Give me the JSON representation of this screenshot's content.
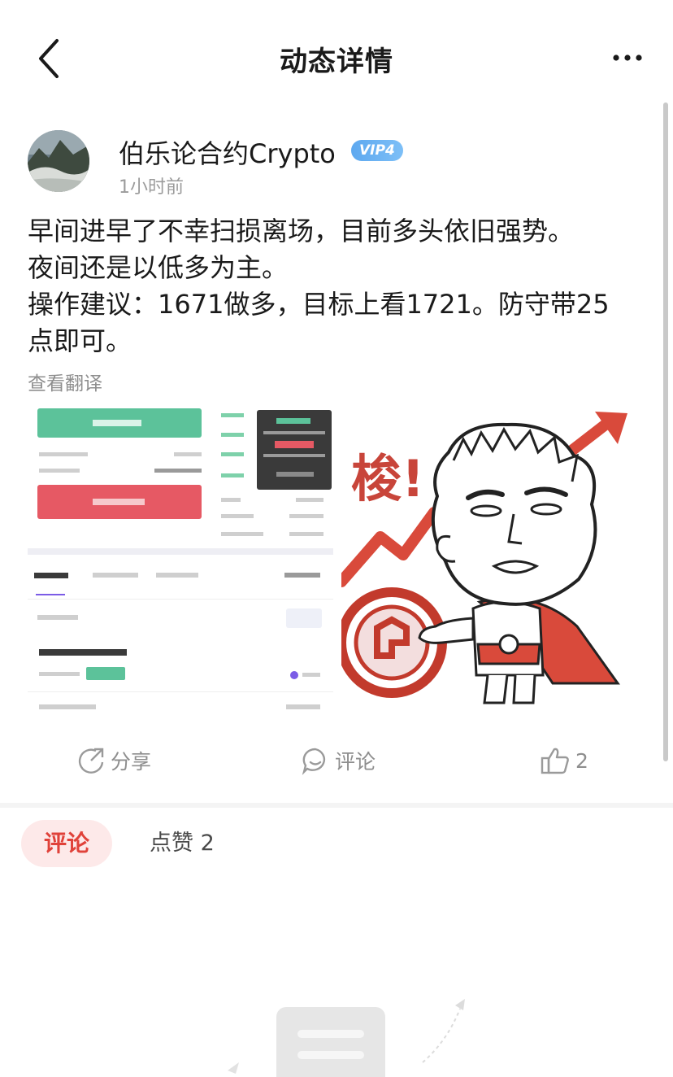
{
  "header": {
    "title": "动态详情",
    "back_icon": "chevron-left-icon",
    "more_icon": "more-horizontal-icon"
  },
  "author": {
    "name": "伯乐论合约Crypto",
    "badge": "VIP4",
    "time": "1小时前"
  },
  "post": {
    "lines": [
      "早间进早了不幸扫损离场，目前多头依旧强势。",
      "夜间还是以低多为主。",
      "操作建议：1671做多，目标上看1721。防守带25",
      "点即可。"
    ],
    "translate_label": "查看翻译"
  },
  "images": {
    "image1_label": "trading-app-screenshot",
    "image2_label": "meme-sticker",
    "meme_text": "梭!"
  },
  "actions": {
    "share_label": "分享",
    "comment_label": "评论",
    "like_count": "2"
  },
  "tabs": {
    "comment_label": "评论",
    "like_label": "点赞 2"
  },
  "colors": {
    "accent_red": "#e0423a",
    "tab_bg": "#fde9e9",
    "vip_blue": "#5da8ef",
    "muted": "#8e8e8e"
  }
}
